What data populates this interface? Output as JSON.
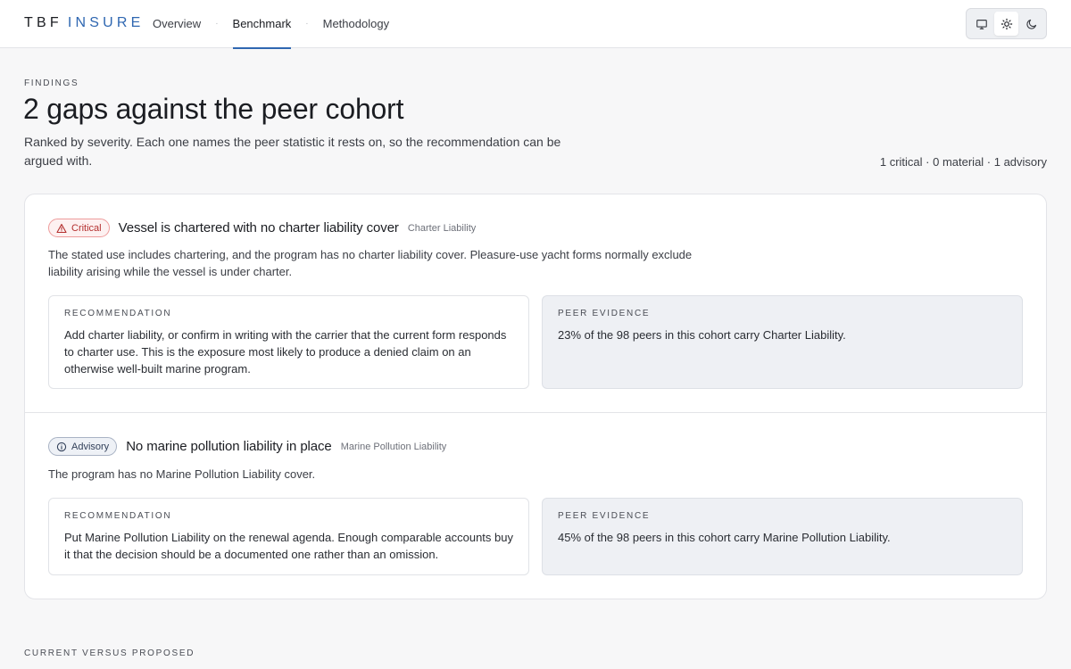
{
  "brand": {
    "part1": "TBF",
    "part2": "INSURE"
  },
  "nav": {
    "items": [
      {
        "label": "Overview",
        "active": false
      },
      {
        "label": "Benchmark",
        "active": true
      },
      {
        "label": "Methodology",
        "active": false
      }
    ],
    "separator": "·"
  },
  "theme_toggle": {
    "options": [
      {
        "icon": "monitor-icon",
        "name": "system",
        "active": false
      },
      {
        "icon": "sun-icon",
        "name": "light",
        "active": true
      },
      {
        "icon": "moon-icon",
        "name": "dark",
        "active": false
      }
    ]
  },
  "header": {
    "eyebrow": "FINDINGS",
    "title": "2 gaps against the peer cohort",
    "subtitle": "Ranked by severity. Each one names the peer statistic it rests on, so the recommendation can be argued with.",
    "tally": "1 critical · 0 material · 1 advisory"
  },
  "findings": [
    {
      "severity": "Critical",
      "severity_icon": "warning-triangle-icon",
      "title": "Vessel is chartered with no charter liability cover",
      "tag": "Charter Liability",
      "description": "The stated use includes chartering, and the program has no charter liability cover. Pleasure-use yacht forms normally exclude liability arising while the vessel is under charter.",
      "recommendation_label": "RECOMMENDATION",
      "recommendation": "Add charter liability, or confirm in writing with the carrier that the current form responds to charter use. This is the exposure most likely to produce a denied claim on an otherwise well-built marine program.",
      "evidence_label": "PEER EVIDENCE",
      "evidence": "23% of the 98 peers in this cohort carry Charter Liability."
    },
    {
      "severity": "Advisory",
      "severity_icon": "info-circle-icon",
      "title": "No marine pollution liability in place",
      "tag": "Marine Pollution Liability",
      "description": "The program has no Marine Pollution Liability cover.",
      "recommendation_label": "RECOMMENDATION",
      "recommendation": "Put Marine Pollution Liability on the renewal agenda. Enough comparable accounts buy it that the decision should be a documented one rather than an omission.",
      "evidence_label": "PEER EVIDENCE",
      "evidence": "45% of the 98 peers in this cohort carry Marine Pollution Liability."
    }
  ],
  "next_section": {
    "eyebrow": "CURRENT VERSUS PROPOSED"
  },
  "colors": {
    "accent": "#2f67b1",
    "critical": "#b4302f",
    "advisory": "#33415a"
  }
}
